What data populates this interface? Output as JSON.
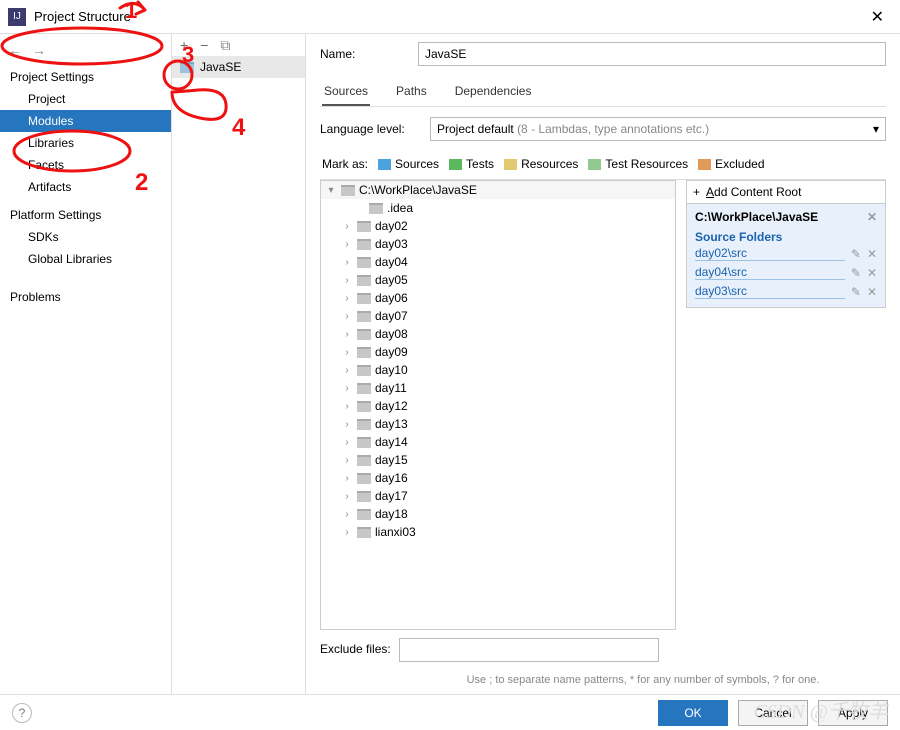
{
  "title": "Project Structure",
  "annotations": [
    "1",
    "2",
    "3",
    "4"
  ],
  "sidebar": {
    "sections": [
      {
        "title": "Project Settings",
        "items": [
          "Project",
          "Modules",
          "Libraries",
          "Facets",
          "Artifacts"
        ],
        "selected": 1
      },
      {
        "title": "Platform Settings",
        "items": [
          "SDKs",
          "Global Libraries"
        ]
      },
      {
        "title": "",
        "items": [
          "Problems"
        ]
      }
    ]
  },
  "module_list": {
    "items": [
      "JavaSE"
    ],
    "toolbar": {
      "add": "+",
      "remove": "−",
      "copy": "⧉"
    }
  },
  "main": {
    "name_label": "Name:",
    "name_value": "JavaSE",
    "tabs": [
      "Sources",
      "Paths",
      "Dependencies"
    ],
    "active_tab": 0,
    "lang_label": "Language level:",
    "lang_value": "Project default",
    "lang_hint": "(8 - Lambdas, type annotations etc.)",
    "mark_label": "Mark as:",
    "marks": [
      {
        "name": "Sources",
        "cls": "c-src"
      },
      {
        "name": "Tests",
        "cls": "c-test"
      },
      {
        "name": "Resources",
        "cls": "c-res"
      },
      {
        "name": "Test Resources",
        "cls": "c-tr"
      },
      {
        "name": "Excluded",
        "cls": "c-ex"
      }
    ],
    "tree_root": "C:\\WorkPlace\\JavaSE",
    "tree_nodes": [
      {
        "name": ".idea",
        "expand": false,
        "leaf": true
      },
      {
        "name": "day02",
        "expand": false
      },
      {
        "name": "day03",
        "expand": false
      },
      {
        "name": "day04",
        "expand": false
      },
      {
        "name": "day05",
        "expand": false
      },
      {
        "name": "day06",
        "expand": false
      },
      {
        "name": "day07",
        "expand": false
      },
      {
        "name": "day08",
        "expand": false
      },
      {
        "name": "day09",
        "expand": false
      },
      {
        "name": "day10",
        "expand": false
      },
      {
        "name": "day11",
        "expand": false
      },
      {
        "name": "day12",
        "expand": false
      },
      {
        "name": "day13",
        "expand": false
      },
      {
        "name": "day14",
        "expand": false
      },
      {
        "name": "day15",
        "expand": false
      },
      {
        "name": "day16",
        "expand": false
      },
      {
        "name": "day17",
        "expand": false
      },
      {
        "name": "day18",
        "expand": false
      },
      {
        "name": "lianxi03",
        "expand": false
      }
    ],
    "add_root": "Add Content Root",
    "content_root": "C:\\WorkPlace\\JavaSE",
    "source_folders_title": "Source Folders",
    "source_folders": [
      "day02\\src",
      "day04\\src",
      "day03\\src"
    ],
    "exclude_label": "Exclude files:",
    "exclude_value": "",
    "exclude_hint": "Use ; to separate name patterns, * for any number of symbols, ? for one."
  },
  "footer": {
    "ok": "OK",
    "cancel": "Cancel",
    "apply": "Apply"
  },
  "watermark": "CSDN @千牧羊"
}
